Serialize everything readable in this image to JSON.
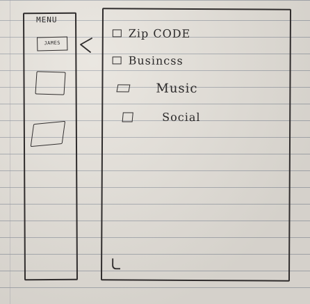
{
  "menu": {
    "title": "MENU",
    "items": [
      {
        "label": "JAMES",
        "icon": "box"
      },
      {
        "label": "",
        "icon": "box"
      },
      {
        "label": "",
        "icon": "box"
      }
    ]
  },
  "arrow": {
    "icon": "left-arrow-icon"
  },
  "options": [
    {
      "label": "Zip CODE"
    },
    {
      "label": "Busincss"
    },
    {
      "label": "Music"
    },
    {
      "label": "Social"
    }
  ]
}
